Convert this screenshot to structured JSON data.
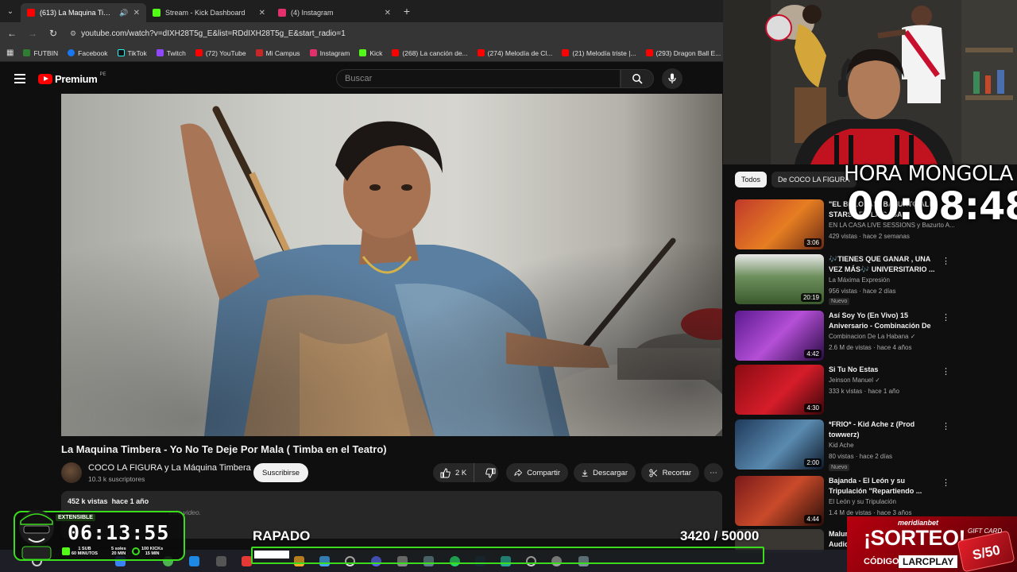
{
  "browser": {
    "tabs": [
      {
        "label": "(613) La Maquina Timbera",
        "color": "#ff0000",
        "active": true
      },
      {
        "label": "Stream - Kick Dashboard",
        "color": "#53fc18",
        "active": false
      },
      {
        "label": "(4) Instagram",
        "color": "#e1306c",
        "active": false
      }
    ],
    "url": "youtube.com/watch?v=dIXH28T5g_E&list=RDdIXH28T5g_E&start_radio=1",
    "bookmarks": [
      "FUTBIN",
      "Facebook",
      "TikTok",
      "Twitch",
      "(72) YouTube",
      "Mi Campus",
      "Instagram",
      "Kick",
      "(268) La canción de...",
      "(274) Melodía de Cl...",
      "(21) Melodía triste |...",
      "(293) Dragon Ball E..."
    ]
  },
  "youtube": {
    "logo": "Premium",
    "region": "PE",
    "search_placeholder": "Buscar"
  },
  "video": {
    "title": "La Maquina Timbera - Yo No Te Deje Por Mala ( Timba en el Teatro)",
    "channel": "COCO LA FIGURA y La Máquina Timbera",
    "subscribers": "10.3 k suscriptores",
    "subscribe_label": "Suscribirse",
    "likes": "2 K",
    "share_label": "Compartir",
    "download_label": "Descargar",
    "clip_label": "Recortar",
    "views": "452 k vistas",
    "age": "hace 1 año",
    "desc_fragment": "este video."
  },
  "sidebar": {
    "chips": [
      "Todos",
      "De COCO LA FIGURA"
    ],
    "items": [
      {
        "title": "\"EL BOLOLA\" - BAZURTO ALL STARS - EN LA CASA",
        "channel": "EN LA CASA LIVE SESSIONS y Bazurto A...",
        "meta": "429 vistas · hace 2 semanas",
        "duration": "3:06",
        "badge": ""
      },
      {
        "title": "🎶TIENES QUE GANAR , UNA VEZ MÁS🎶 UNIVERSITARIO ...",
        "channel": "La Máxima Expresión",
        "meta": "956 vistas · hace 2 días",
        "duration": "20:19",
        "badge": "Nuevo"
      },
      {
        "title": "Así Soy Yo (En Vivo) 15 Aniversario - Combinación De ...",
        "channel": "Combinacion De La Habana ✓",
        "meta": "2.6 M de vistas · hace 4 años",
        "duration": "4:42",
        "badge": ""
      },
      {
        "title": "Si Tu No Estas",
        "channel": "Jeinson Manuel ✓",
        "meta": "333 k vistas · hace 1 año",
        "duration": "4:30",
        "badge": ""
      },
      {
        "title": "*FRIO* - Kid Ache z (Prod towwerz)",
        "channel": "Kid Ache",
        "meta": "80 vistas · hace 2 días",
        "duration": "2:00",
        "badge": "Nuevo"
      },
      {
        "title": "Bajanda - El León y su Tripulación \"Repartiendo ...",
        "channel": "El León y su Tripulación",
        "meta": "1.4 M de vistas · hace 3 años",
        "duration": "4:44",
        "badge": ""
      },
      {
        "title": "Malum",
        "channel": "Audic",
        "meta": "",
        "duration": "",
        "badge": ""
      }
    ]
  },
  "overlay": {
    "hora_label": "HORA MONGOLA",
    "clock": "00:08:48",
    "timer": {
      "extensible": "EXTENSIBLE",
      "time": "06:13:55",
      "sub1": "1 SUB\n60 MINUTOS",
      "sub2": "5 soles\n20 MIN",
      "sub3": "100 KICKs\n15 MIN"
    },
    "goal_label": "RAPADO",
    "goal_current": "3420",
    "goal_total": "/ 50000",
    "goal_progress": 0.0684,
    "sorteo": {
      "brand": "meridianbet",
      "title": "¡SORTEO!",
      "code_label": "CÓDIGO:",
      "code": "LARCPLAY",
      "gift": "GIFT CARD",
      "price": "S/50"
    }
  },
  "colors": {
    "accent": "#ff0000",
    "overlay_green": "#3bdc1e",
    "kick_green": "#53fc18"
  }
}
